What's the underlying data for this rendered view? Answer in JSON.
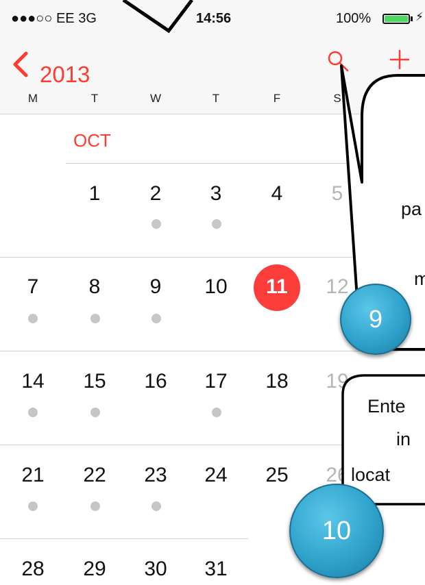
{
  "status_bar": {
    "carrier": "●●●○○ EE  3G",
    "time": "14:56",
    "battery_text": "100%",
    "battery_level": 1.0,
    "battery_color": "#4cd964",
    "charging_icon": "bolt-icon"
  },
  "nav_bar": {
    "back_label": "2013",
    "back_icon": "chevron-left-icon",
    "search_icon": "search-icon",
    "add_icon": "plus-icon",
    "accent_color": "#ff3b30"
  },
  "weekdays": [
    "M",
    "T",
    "W",
    "T",
    "F",
    "S"
  ],
  "calendar": {
    "month": "OCT",
    "today": "11",
    "today_color": "#fc3d39",
    "weeks": [
      {
        "days": [
          "",
          "1",
          "2",
          "3",
          "4",
          "5"
        ]
      },
      {
        "days": [
          "7",
          "8",
          "9",
          "10",
          "11",
          "12"
        ]
      },
      {
        "days": [
          "14",
          "15",
          "16",
          "17",
          "18",
          "19"
        ]
      },
      {
        "days": [
          "21",
          "22",
          "23",
          "24",
          "25",
          "26"
        ]
      },
      {
        "days": [
          "28",
          "29",
          "30",
          "31",
          "",
          ""
        ]
      }
    ]
  },
  "annotations": {
    "callout_9": {
      "line1": "pa",
      "line2": "m"
    },
    "callout_10": {
      "line1": "Ente",
      "line2": "in",
      "line3": "locat"
    },
    "badge_9": "9",
    "badge_10": "10",
    "badge_color": "#2fa3cc"
  }
}
